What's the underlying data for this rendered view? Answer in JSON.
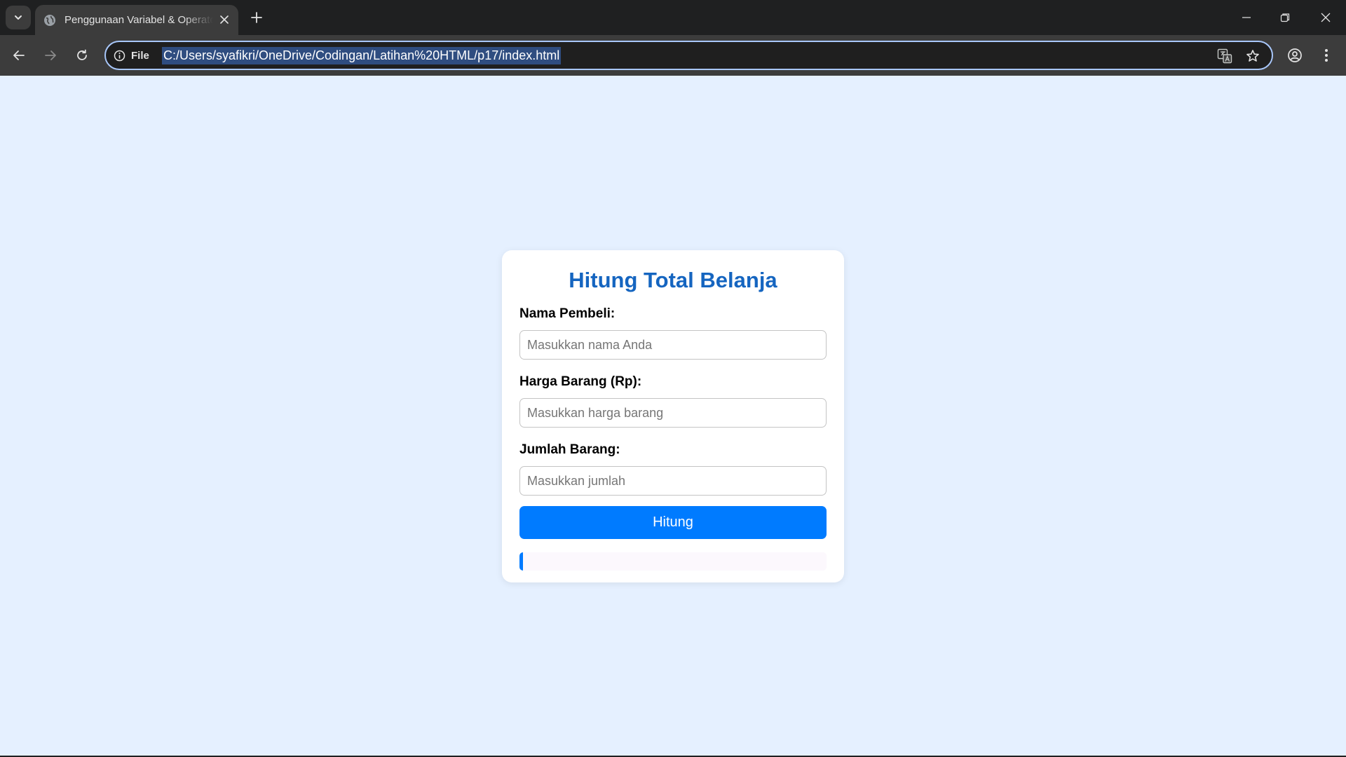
{
  "browser": {
    "tab": {
      "title": "Penggunaan Variabel & Operator"
    },
    "omnibox": {
      "site_info_label": "File",
      "url": "C:/Users/syafikri/OneDrive/Codingan/Latihan%20HTML/p17/index.html"
    }
  },
  "page": {
    "title": "Hitung Total Belanja",
    "fields": [
      {
        "label": "Nama Pembeli:",
        "placeholder": "Masukkan nama Anda",
        "value": ""
      },
      {
        "label": "Harga Barang (Rp):",
        "placeholder": "Masukkan harga barang",
        "value": ""
      },
      {
        "label": "Jumlah Barang:",
        "placeholder": "Masukkan jumlah",
        "value": ""
      }
    ],
    "submit_label": "Hitung",
    "result_text": ""
  },
  "colors": {
    "page_background": "#e5f0ff",
    "title": "#1565c0",
    "accent": "#007bff",
    "card": "#ffffff",
    "result_background": "#fcf8fd"
  }
}
